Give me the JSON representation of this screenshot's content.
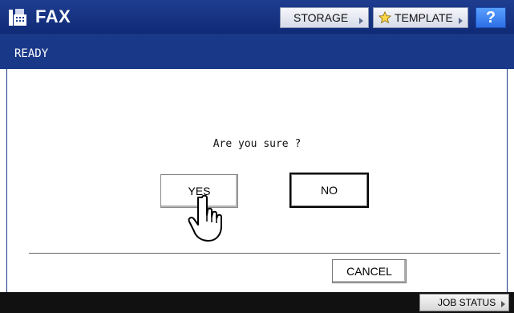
{
  "header": {
    "title": "FAX",
    "icon": "fax-icon",
    "storage_label": "STORAGE",
    "template_label": "TEMPLATE",
    "help_label": "?",
    "accent_color": "#1a3888"
  },
  "status": {
    "text": "READY"
  },
  "dialog": {
    "question": "Are you sure ?",
    "yes_label": "YES",
    "no_label": "NO",
    "cancel_label": "CANCEL"
  },
  "footer": {
    "job_status_label": "JOB STATUS"
  }
}
